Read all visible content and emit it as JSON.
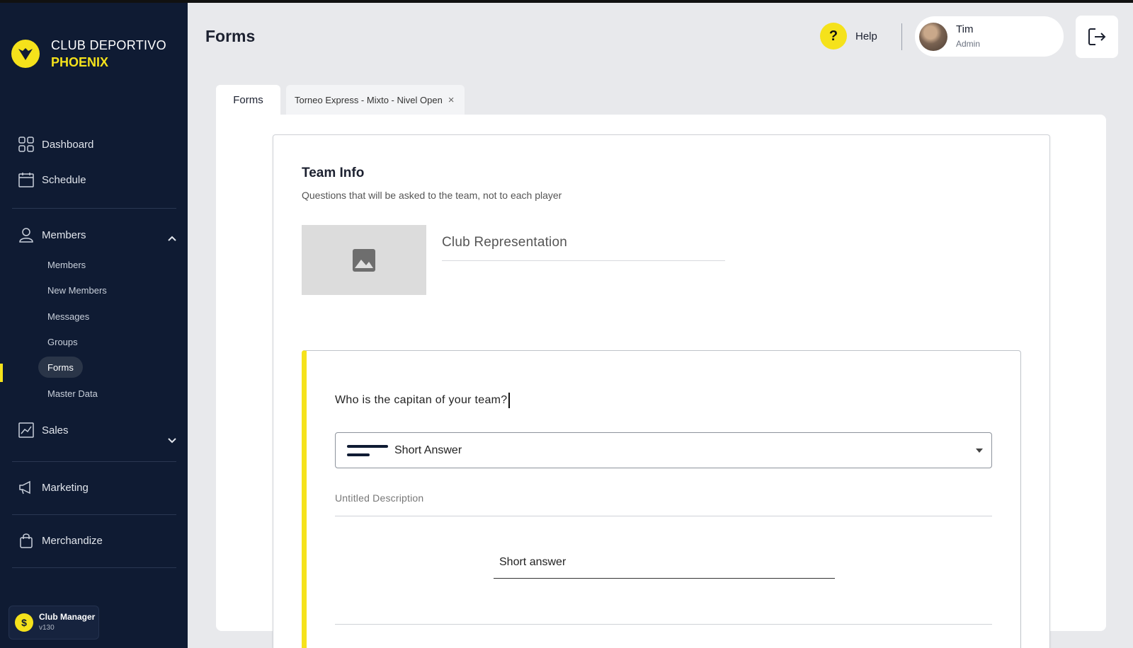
{
  "brand": {
    "line1": "CLUB DEPORTIVO",
    "line2": "PHOENIX",
    "logo_icon": "phoenix-bird-icon",
    "accent": "#f5e21b"
  },
  "sidebar": {
    "items": [
      {
        "label": "Dashboard",
        "icon": "grid-icon"
      },
      {
        "label": "Schedule",
        "icon": "calendar-icon"
      },
      {
        "label": "Members",
        "icon": "user-icon",
        "expanded": true
      },
      {
        "label": "Sales",
        "icon": "chart-icon",
        "expanded": false
      },
      {
        "label": "Marketing",
        "icon": "megaphone-icon"
      },
      {
        "label": "Merchandize",
        "icon": "bag-icon"
      }
    ],
    "members_sub": [
      "Members",
      "New Members",
      "Messages",
      "Groups",
      "Forms",
      "Master Data"
    ],
    "active_sub": "Forms",
    "badge": {
      "title": "Club Manager",
      "version": "v130"
    }
  },
  "header": {
    "title": "Forms",
    "help_label": "Help",
    "help_symbol": "?",
    "user": {
      "name": "Tim",
      "role": "Admin"
    }
  },
  "tabs": [
    {
      "label": "Forms"
    },
    {
      "label": "Torneo Express - Mixto - Nivel Open",
      "closable": true,
      "close_symbol": "×"
    }
  ],
  "form": {
    "section_title": "Team Info",
    "section_subtitle": "Questions that will be asked to the team, not to each player",
    "image_placeholder_icon": "image-icon",
    "title_field": "Club Representation",
    "question": {
      "text": "Who is the capitan of your team?",
      "type": "Short Answer",
      "description_placeholder": "Untitled Description",
      "answer_preview": "Short answer"
    }
  }
}
